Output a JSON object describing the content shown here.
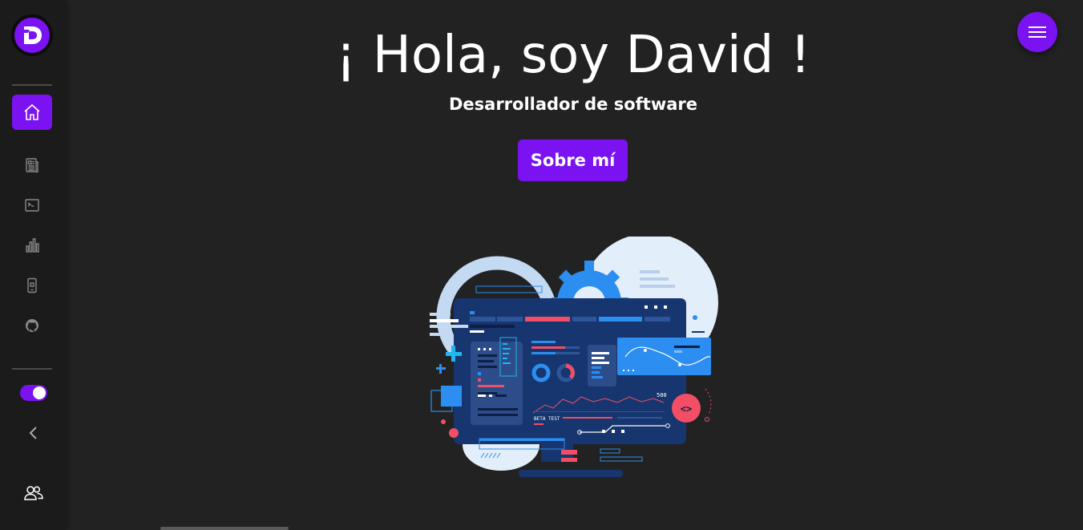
{
  "hero": {
    "title": "¡ Hola, soy David !",
    "subtitle": "Desarrollador de software",
    "cta_label": "Sobre mí"
  },
  "sidebar": {
    "logo_letter": "D",
    "items": [
      {
        "name": "home",
        "icon": "home-icon",
        "active": true
      },
      {
        "name": "blog",
        "icon": "newspaper-icon",
        "active": false
      },
      {
        "name": "terminal",
        "icon": "terminal-icon",
        "active": false
      },
      {
        "name": "stats",
        "icon": "bar-chart-icon",
        "active": false
      },
      {
        "name": "mobile",
        "icon": "phone-icon",
        "active": false
      },
      {
        "name": "github",
        "icon": "github-icon",
        "active": false
      }
    ],
    "theme_toggle_on": true
  },
  "illustration": {
    "beta_label": "BETA TEST",
    "chart_value": "500",
    "code_symbol": "<>"
  },
  "colors": {
    "accent": "#7a12f2",
    "background": "#222222",
    "sidebar": "#1b1b1b"
  }
}
